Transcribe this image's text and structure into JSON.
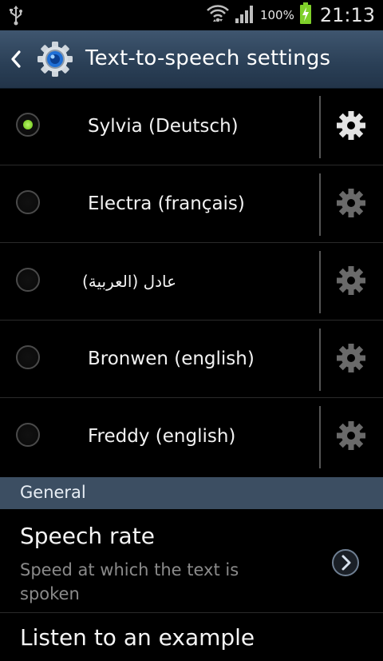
{
  "status_bar": {
    "battery_percent": "100%",
    "time": "21:13",
    "icons": [
      "usb-icon",
      "wifi-icon",
      "signal-icon",
      "battery-charging-icon"
    ]
  },
  "action_bar": {
    "title": "Text-to-speech settings",
    "back_icon": "chevron-left-icon",
    "app_icon": "settings-gear-icon"
  },
  "engines": [
    {
      "label": "Sylvia (Deutsch)",
      "selected": true
    },
    {
      "label": "Electra (français)",
      "selected": false
    },
    {
      "label": "عادل (العربية)",
      "selected": false
    },
    {
      "label": "Bronwen (english)",
      "selected": false
    },
    {
      "label": "Freddy (english)",
      "selected": false
    }
  ],
  "general": {
    "header": "General",
    "speech_rate": {
      "title": "Speech rate",
      "summary": "Speed at which the text is spoken"
    },
    "listen_example": {
      "title": "Listen to an example"
    }
  },
  "colors": {
    "accent_green": "#7fd02a",
    "action_bar": "#2f4a64",
    "section_header": "#3c4e62"
  }
}
